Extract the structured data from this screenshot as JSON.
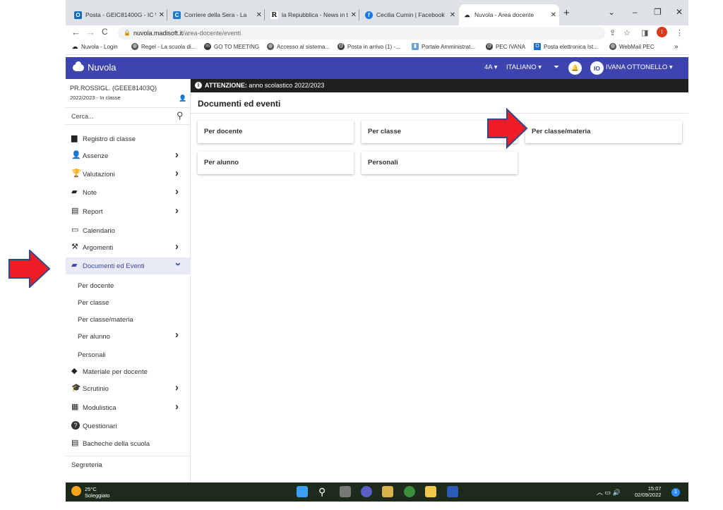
{
  "browser": {
    "tabs": [
      {
        "title": "Posta - GEIC81400G - IC \\",
        "icon": "outlook-icon",
        "color": "#0f6cbd"
      },
      {
        "title": "Corriere della Sera - La ",
        "icon": "corriere-icon",
        "color": "#1f7ac9"
      },
      {
        "title": "la Repubblica - News in t",
        "icon": "repubblica-icon",
        "color": "#222222"
      },
      {
        "title": "Cecilia Cumin | Facebook",
        "icon": "facebook-icon",
        "color": "#1877f2"
      },
      {
        "title": "Nuvola - Area docente",
        "icon": "cloud-icon",
        "color": "#222222"
      }
    ],
    "url_host": "nuvola.madisoft.it",
    "url_path": "/area-docente/eventi",
    "bookmarks": [
      "Nuvola - Login",
      "Regel - La scuola di...",
      "GO TO MEETING",
      "Accesso al sistema...",
      "Posta in arrivo (1) -...",
      "Portale Amministrat...",
      "PEC IVANA",
      "Posta elettronica Ist...",
      "WebMail PEC"
    ],
    "profile_initial": "I"
  },
  "app": {
    "name": "Nuvola",
    "class": "4A",
    "subject": "ITALIANO",
    "user_initials": "IO",
    "user_name": "IVANA OTTONELLO",
    "accent": "#3d44b0"
  },
  "sidebar": {
    "user": "PR.ROSSIGL. (GEEE81403Q)",
    "status": "2022/2023 - In classe",
    "search_placeholder": "Cerca...",
    "items": [
      {
        "label": "Registro di classe",
        "icon": "book-icon"
      },
      {
        "label": "Assenze",
        "icon": "user-check-icon"
      },
      {
        "label": "Valutazioni",
        "icon": "trophy-icon"
      },
      {
        "label": "Note",
        "icon": "note-icon"
      },
      {
        "label": "Report",
        "icon": "report-icon"
      },
      {
        "label": "Calendario",
        "icon": "calendar-icon"
      },
      {
        "label": "Argomenti",
        "icon": "compass-icon"
      },
      {
        "label": "Documenti ed Eventi",
        "icon": "folder-open-icon"
      }
    ],
    "subitems": [
      "Per docente",
      "Per classe",
      "Per classe/materia",
      "Per alunno",
      "Personali"
    ],
    "items2": [
      {
        "label": "Materiale per docente",
        "icon": "shapes-icon"
      },
      {
        "label": "Scrutinio",
        "icon": "graduation-cap-icon"
      },
      {
        "label": "Modulistica",
        "icon": "forms-icon"
      },
      {
        "label": "Questionari",
        "icon": "question-icon"
      },
      {
        "label": "Bacheche della scuola",
        "icon": "board-icon"
      }
    ],
    "footer": "Segreteria"
  },
  "main": {
    "banner_bold": "ATTENZIONE:",
    "banner_text": "anno scolastico 2022/2023",
    "title": "Documenti ed eventi",
    "cards": [
      "Per docente",
      "Per classe",
      "Per classe/materia",
      "Per alunno",
      "Personali"
    ]
  },
  "taskbar": {
    "temperature": "25°C",
    "weather": "Soleggiato",
    "time": "15:07",
    "date": "02/09/2022"
  }
}
